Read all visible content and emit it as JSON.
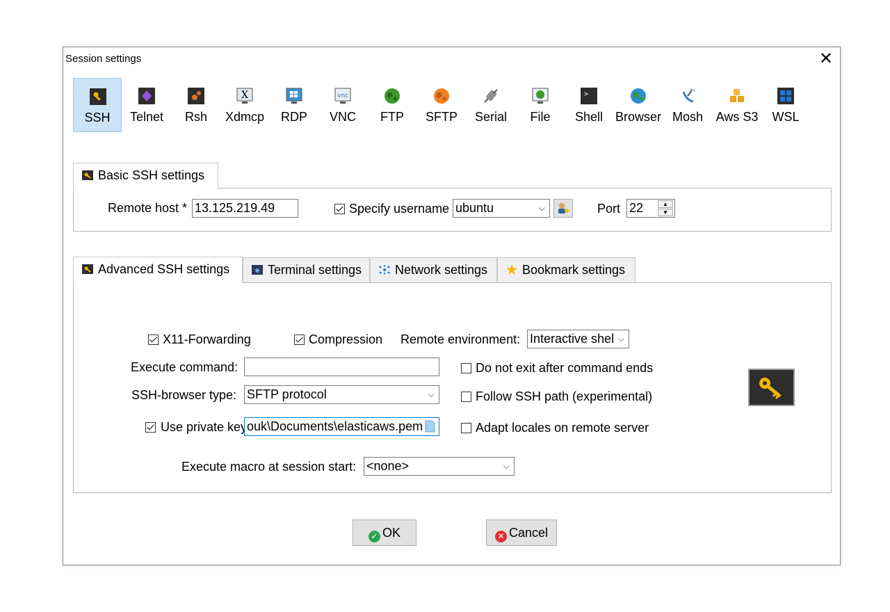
{
  "window": {
    "title": "Session settings"
  },
  "session_types": [
    {
      "label": "SSH",
      "icon": "key-icon",
      "color": "#e8a800",
      "selected": true
    },
    {
      "label": "Telnet",
      "icon": "telnet-icon",
      "color": "#7b2fbf"
    },
    {
      "label": "Rsh",
      "icon": "rsh-icon",
      "color": "#e07020"
    },
    {
      "label": "Xdmcp",
      "icon": "xdmcp-icon",
      "color": "#444444"
    },
    {
      "label": "RDP",
      "icon": "rdp-icon",
      "color": "#2a80c0"
    },
    {
      "label": "VNC",
      "icon": "vnc-icon",
      "color": "#3070c0"
    },
    {
      "label": "FTP",
      "icon": "ftp-globe-icon",
      "color": "#3a9a2a"
    },
    {
      "label": "SFTP",
      "icon": "sftp-globe-icon",
      "color": "#f08020"
    },
    {
      "label": "Serial",
      "icon": "serial-plug-icon",
      "color": "#808080"
    },
    {
      "label": "File",
      "icon": "file-monitor-icon",
      "color": "#3a8ac0"
    },
    {
      "label": "Shell",
      "icon": "shell-terminal-icon",
      "color": "#2d2d2d"
    },
    {
      "label": "Browser",
      "icon": "browser-globe-icon",
      "color": "#2a90d0"
    },
    {
      "label": "Mosh",
      "icon": "mosh-antenna-icon",
      "color": "#4080c0"
    },
    {
      "label": "Aws S3",
      "icon": "aws-s3-cubes-icon",
      "color": "#f0a020"
    },
    {
      "label": "WSL",
      "icon": "windows-icon",
      "color": "#1f78d1"
    }
  ],
  "basic": {
    "tab_label": "Basic SSH settings",
    "remote_host_label": "Remote host *",
    "remote_host_value": "13.125.219.49",
    "specify_username_label": "Specify username",
    "specify_username_checked": true,
    "username_value": "ubuntu",
    "port_label": "Port",
    "port_value": "22"
  },
  "tabs": [
    {
      "label": "Advanced SSH settings",
      "icon": "key-icon",
      "active": true
    },
    {
      "label": "Terminal settings",
      "icon": "terminal-icon"
    },
    {
      "label": "Network settings",
      "icon": "network-icon"
    },
    {
      "label": "Bookmark settings",
      "icon": "star-icon"
    }
  ],
  "advanced": {
    "x11_label": "X11-Forwarding",
    "x11_checked": true,
    "compression_label": "Compression",
    "compression_checked": true,
    "remote_env_label": "Remote environment:",
    "remote_env_value": "Interactive shel",
    "execute_command_label": "Execute command:",
    "execute_command_value": "",
    "do_not_exit_label": "Do not exit after command ends",
    "browser_type_label": "SSH-browser type:",
    "browser_type_value": "SFTP protocol",
    "follow_path_label": "Follow SSH path (experimental)",
    "private_key_label": "Use private key",
    "private_key_checked": true,
    "private_key_value": "ouk\\Documents\\elasticaws.pem",
    "adapt_locales_label": "Adapt locales on remote server",
    "macro_label": "Execute macro at session start:",
    "macro_value": "<none>"
  },
  "buttons": {
    "ok": "OK",
    "cancel": "Cancel"
  },
  "colors": {
    "selected_bg": "#cce4f7",
    "ok_green": "#2ea44f",
    "cancel_red": "#e03030",
    "key_gold": "#f0b800"
  }
}
